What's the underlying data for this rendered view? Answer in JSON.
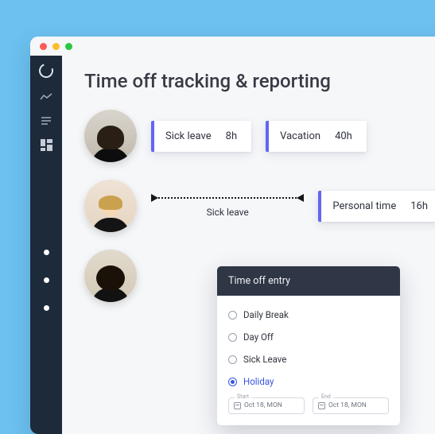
{
  "page": {
    "title": "Time off tracking & reporting"
  },
  "rows": [
    {
      "cards": [
        {
          "label": "Sick leave",
          "hours": "8h"
        },
        {
          "label": "Vacation",
          "hours": "40h"
        }
      ]
    },
    {
      "connector_label": "Sick leave",
      "cards": [
        {
          "label": "Personal time",
          "hours": "16h"
        }
      ]
    },
    {
      "cards": []
    }
  ],
  "entry": {
    "title": "Time off entry",
    "options": [
      "Daily Break",
      "Day Off",
      "Sick Leave",
      "Holiday"
    ],
    "selected_index": 3,
    "dates": {
      "start": {
        "label": "Start",
        "value": "Oct 18, MON"
      },
      "end": {
        "label": "End",
        "value": "Oct 18, MON"
      }
    }
  }
}
